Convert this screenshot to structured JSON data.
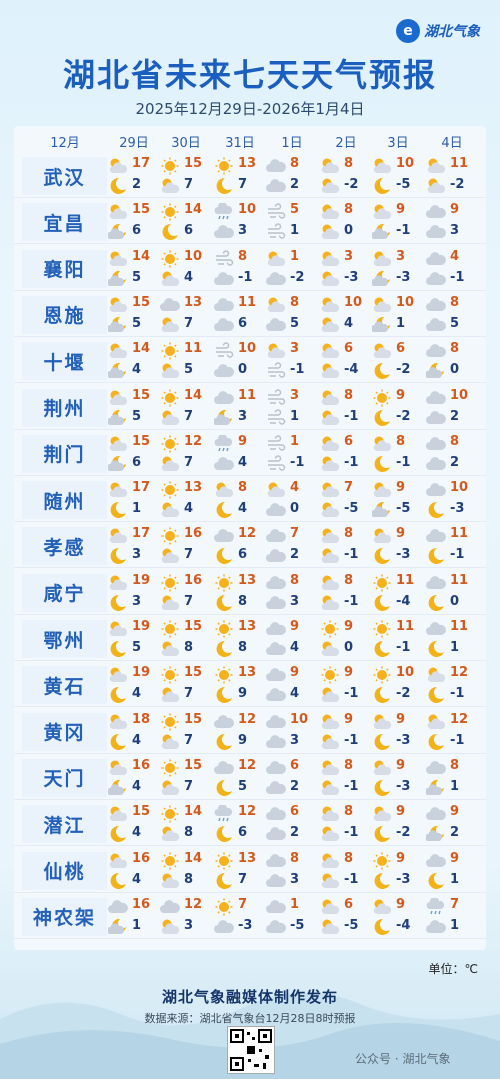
{
  "brand": {
    "logo_text": "湖北气象"
  },
  "title": "湖北省未来七天天气预报",
  "subtitle": "2025年12月29日-2026年1月4日",
  "header": {
    "month": "12月",
    "days": [
      "29日",
      "30日",
      "31日",
      "1日",
      "2日",
      "3日",
      "4日"
    ]
  },
  "rows": [
    {
      "city": "武汉",
      "days": [
        {
          "ti": "pc_day",
          "hi": "17",
          "bi": "moon",
          "lo": "2"
        },
        {
          "ti": "sun",
          "hi": "15",
          "bi": "pc_day",
          "lo": "7"
        },
        {
          "ti": "sun",
          "hi": "13",
          "bi": "moon",
          "lo": "7"
        },
        {
          "ti": "cloud",
          "hi": "8",
          "bi": "cloud",
          "lo": "2"
        },
        {
          "ti": "pc_day",
          "hi": "8",
          "bi": "pc_day",
          "lo": "-2"
        },
        {
          "ti": "pc_day",
          "hi": "10",
          "bi": "moon",
          "lo": "-5"
        },
        {
          "ti": "pc_day",
          "hi": "11",
          "bi": "pc_day",
          "lo": "-2"
        }
      ]
    },
    {
      "city": "宜昌",
      "days": [
        {
          "ti": "pc_day",
          "hi": "15",
          "bi": "pc_night",
          "lo": "6"
        },
        {
          "ti": "sun",
          "hi": "14",
          "bi": "moon",
          "lo": "6"
        },
        {
          "ti": "rain",
          "hi": "10",
          "bi": "cloud",
          "lo": "3"
        },
        {
          "ti": "wind",
          "hi": "5",
          "bi": "wind",
          "lo": "1"
        },
        {
          "ti": "pc_day",
          "hi": "8",
          "bi": "pc_day",
          "lo": "0"
        },
        {
          "ti": "pc_day",
          "hi": "9",
          "bi": "pc_night",
          "lo": "-1"
        },
        {
          "ti": "cloud",
          "hi": "9",
          "bi": "cloud",
          "lo": "3"
        }
      ]
    },
    {
      "city": "襄阳",
      "days": [
        {
          "ti": "pc_day",
          "hi": "14",
          "bi": "pc_night",
          "lo": "5"
        },
        {
          "ti": "sun",
          "hi": "10",
          "bi": "pc_day",
          "lo": "4"
        },
        {
          "ti": "wind",
          "hi": "8",
          "bi": "cloud",
          "lo": "-1"
        },
        {
          "ti": "pc_day",
          "hi": "1",
          "bi": "cloud",
          "lo": "-2"
        },
        {
          "ti": "pc_day",
          "hi": "3",
          "bi": "pc_day",
          "lo": "-3"
        },
        {
          "ti": "pc_day",
          "hi": "3",
          "bi": "pc_night",
          "lo": "-3"
        },
        {
          "ti": "cloud",
          "hi": "4",
          "bi": "cloud",
          "lo": "-1"
        }
      ]
    },
    {
      "city": "恩施",
      "days": [
        {
          "ti": "pc_day",
          "hi": "15",
          "bi": "pc_night",
          "lo": "5"
        },
        {
          "ti": "cloud",
          "hi": "13",
          "bi": "pc_day",
          "lo": "7"
        },
        {
          "ti": "cloud",
          "hi": "11",
          "bi": "cloud",
          "lo": "6"
        },
        {
          "ti": "pc_day",
          "hi": "8",
          "bi": "cloud",
          "lo": "5"
        },
        {
          "ti": "pc_day",
          "hi": "10",
          "bi": "pc_day",
          "lo": "4"
        },
        {
          "ti": "pc_day",
          "hi": "10",
          "bi": "pc_night",
          "lo": "1"
        },
        {
          "ti": "cloud",
          "hi": "8",
          "bi": "cloud",
          "lo": "5"
        }
      ]
    },
    {
      "city": "十堰",
      "days": [
        {
          "ti": "pc_day",
          "hi": "14",
          "bi": "pc_night",
          "lo": "4"
        },
        {
          "ti": "sun",
          "hi": "11",
          "bi": "pc_day",
          "lo": "5"
        },
        {
          "ti": "wind",
          "hi": "10",
          "bi": "cloud",
          "lo": "0"
        },
        {
          "ti": "pc_day",
          "hi": "3",
          "bi": "wind",
          "lo": "-1"
        },
        {
          "ti": "pc_day",
          "hi": "6",
          "bi": "pc_day",
          "lo": "-4"
        },
        {
          "ti": "pc_day",
          "hi": "6",
          "bi": "moon",
          "lo": "-2"
        },
        {
          "ti": "cloud",
          "hi": "8",
          "bi": "pc_night",
          "lo": "0"
        }
      ]
    },
    {
      "city": "荆州",
      "days": [
        {
          "ti": "pc_day",
          "hi": "15",
          "bi": "pc_night",
          "lo": "5"
        },
        {
          "ti": "sun",
          "hi": "14",
          "bi": "pc_day",
          "lo": "7"
        },
        {
          "ti": "cloud",
          "hi": "11",
          "bi": "pc_night",
          "lo": "3"
        },
        {
          "ti": "wind",
          "hi": "3",
          "bi": "wind",
          "lo": "1"
        },
        {
          "ti": "pc_day",
          "hi": "8",
          "bi": "pc_day",
          "lo": "-1"
        },
        {
          "ti": "sun",
          "hi": "9",
          "bi": "moon",
          "lo": "-2"
        },
        {
          "ti": "cloud",
          "hi": "10",
          "bi": "cloud",
          "lo": "2"
        }
      ]
    },
    {
      "city": "荆门",
      "days": [
        {
          "ti": "pc_day",
          "hi": "15",
          "bi": "pc_night",
          "lo": "6"
        },
        {
          "ti": "sun",
          "hi": "12",
          "bi": "pc_day",
          "lo": "7"
        },
        {
          "ti": "rain",
          "hi": "9",
          "bi": "cloud",
          "lo": "4"
        },
        {
          "ti": "wind",
          "hi": "1",
          "bi": "wind",
          "lo": "-1"
        },
        {
          "ti": "pc_day",
          "hi": "6",
          "bi": "pc_day",
          "lo": "-1"
        },
        {
          "ti": "pc_day",
          "hi": "8",
          "bi": "moon",
          "lo": "-1"
        },
        {
          "ti": "cloud",
          "hi": "8",
          "bi": "cloud",
          "lo": "2"
        }
      ]
    },
    {
      "city": "随州",
      "days": [
        {
          "ti": "pc_day",
          "hi": "17",
          "bi": "moon",
          "lo": "1"
        },
        {
          "ti": "sun",
          "hi": "13",
          "bi": "pc_day",
          "lo": "4"
        },
        {
          "ti": "pc_day",
          "hi": "8",
          "bi": "moon",
          "lo": "4"
        },
        {
          "ti": "pc_day",
          "hi": "4",
          "bi": "cloud",
          "lo": "0"
        },
        {
          "ti": "pc_day",
          "hi": "7",
          "bi": "pc_day",
          "lo": "-5"
        },
        {
          "ti": "pc_day",
          "hi": "9",
          "bi": "pc_night",
          "lo": "-5"
        },
        {
          "ti": "cloud",
          "hi": "10",
          "bi": "moon",
          "lo": "-3"
        }
      ]
    },
    {
      "city": "孝感",
      "days": [
        {
          "ti": "pc_day",
          "hi": "17",
          "bi": "moon",
          "lo": "3"
        },
        {
          "ti": "sun",
          "hi": "16",
          "bi": "pc_day",
          "lo": "7"
        },
        {
          "ti": "cloud",
          "hi": "12",
          "bi": "moon",
          "lo": "6"
        },
        {
          "ti": "cloud",
          "hi": "7",
          "bi": "cloud",
          "lo": "2"
        },
        {
          "ti": "pc_day",
          "hi": "8",
          "bi": "pc_day",
          "lo": "-1"
        },
        {
          "ti": "pc_day",
          "hi": "9",
          "bi": "moon",
          "lo": "-3"
        },
        {
          "ti": "cloud",
          "hi": "11",
          "bi": "moon",
          "lo": "-1"
        }
      ]
    },
    {
      "city": "咸宁",
      "days": [
        {
          "ti": "pc_day",
          "hi": "19",
          "bi": "moon",
          "lo": "3"
        },
        {
          "ti": "sun",
          "hi": "16",
          "bi": "pc_day",
          "lo": "7"
        },
        {
          "ti": "sun",
          "hi": "13",
          "bi": "moon",
          "lo": "8"
        },
        {
          "ti": "cloud",
          "hi": "8",
          "bi": "cloud",
          "lo": "3"
        },
        {
          "ti": "pc_day",
          "hi": "8",
          "bi": "pc_day",
          "lo": "-1"
        },
        {
          "ti": "sun",
          "hi": "11",
          "bi": "moon",
          "lo": "-4"
        },
        {
          "ti": "cloud",
          "hi": "11",
          "bi": "moon",
          "lo": "0"
        }
      ]
    },
    {
      "city": "鄂州",
      "days": [
        {
          "ti": "pc_day",
          "hi": "19",
          "bi": "moon",
          "lo": "5"
        },
        {
          "ti": "sun",
          "hi": "15",
          "bi": "pc_day",
          "lo": "8"
        },
        {
          "ti": "sun",
          "hi": "13",
          "bi": "moon",
          "lo": "8"
        },
        {
          "ti": "cloud",
          "hi": "9",
          "bi": "cloud",
          "lo": "4"
        },
        {
          "ti": "sun",
          "hi": "9",
          "bi": "pc_day",
          "lo": "0"
        },
        {
          "ti": "sun",
          "hi": "11",
          "bi": "moon",
          "lo": "-1"
        },
        {
          "ti": "cloud",
          "hi": "11",
          "bi": "moon",
          "lo": "1"
        }
      ]
    },
    {
      "city": "黄石",
      "days": [
        {
          "ti": "pc_day",
          "hi": "19",
          "bi": "moon",
          "lo": "4"
        },
        {
          "ti": "sun",
          "hi": "15",
          "bi": "pc_day",
          "lo": "7"
        },
        {
          "ti": "sun",
          "hi": "13",
          "bi": "moon",
          "lo": "9"
        },
        {
          "ti": "cloud",
          "hi": "9",
          "bi": "cloud",
          "lo": "4"
        },
        {
          "ti": "sun",
          "hi": "9",
          "bi": "pc_day",
          "lo": "-1"
        },
        {
          "ti": "sun",
          "hi": "10",
          "bi": "moon",
          "lo": "-2"
        },
        {
          "ti": "pc_day",
          "hi": "12",
          "bi": "moon",
          "lo": "-1"
        }
      ]
    },
    {
      "city": "黄冈",
      "days": [
        {
          "ti": "pc_day",
          "hi": "18",
          "bi": "moon",
          "lo": "4"
        },
        {
          "ti": "sun",
          "hi": "15",
          "bi": "pc_day",
          "lo": "7"
        },
        {
          "ti": "cloud",
          "hi": "12",
          "bi": "moon",
          "lo": "9"
        },
        {
          "ti": "cloud",
          "hi": "10",
          "bi": "cloud",
          "lo": "3"
        },
        {
          "ti": "pc_day",
          "hi": "9",
          "bi": "pc_day",
          "lo": "-1"
        },
        {
          "ti": "pc_day",
          "hi": "9",
          "bi": "moon",
          "lo": "-3"
        },
        {
          "ti": "pc_day",
          "hi": "12",
          "bi": "moon",
          "lo": "-1"
        }
      ]
    },
    {
      "city": "天门",
      "days": [
        {
          "ti": "pc_day",
          "hi": "16",
          "bi": "pc_night",
          "lo": "4"
        },
        {
          "ti": "sun",
          "hi": "15",
          "bi": "pc_day",
          "lo": "7"
        },
        {
          "ti": "cloud",
          "hi": "12",
          "bi": "moon",
          "lo": "5"
        },
        {
          "ti": "cloud",
          "hi": "6",
          "bi": "cloud",
          "lo": "2"
        },
        {
          "ti": "pc_day",
          "hi": "8",
          "bi": "pc_day",
          "lo": "-1"
        },
        {
          "ti": "pc_day",
          "hi": "9",
          "bi": "moon",
          "lo": "-3"
        },
        {
          "ti": "cloud",
          "hi": "8",
          "bi": "pc_night",
          "lo": "1"
        }
      ]
    },
    {
      "city": "潜江",
      "days": [
        {
          "ti": "pc_day",
          "hi": "15",
          "bi": "moon",
          "lo": "4"
        },
        {
          "ti": "sun",
          "hi": "14",
          "bi": "pc_day",
          "lo": "8"
        },
        {
          "ti": "rain",
          "hi": "12",
          "bi": "moon",
          "lo": "6"
        },
        {
          "ti": "cloud",
          "hi": "6",
          "bi": "cloud",
          "lo": "2"
        },
        {
          "ti": "pc_day",
          "hi": "8",
          "bi": "pc_day",
          "lo": "-1"
        },
        {
          "ti": "pc_day",
          "hi": "9",
          "bi": "moon",
          "lo": "-2"
        },
        {
          "ti": "cloud",
          "hi": "9",
          "bi": "pc_night",
          "lo": "2"
        }
      ]
    },
    {
      "city": "仙桃",
      "days": [
        {
          "ti": "pc_day",
          "hi": "16",
          "bi": "moon",
          "lo": "4"
        },
        {
          "ti": "sun",
          "hi": "14",
          "bi": "pc_day",
          "lo": "8"
        },
        {
          "ti": "sun",
          "hi": "13",
          "bi": "moon",
          "lo": "7"
        },
        {
          "ti": "cloud",
          "hi": "8",
          "bi": "cloud",
          "lo": "3"
        },
        {
          "ti": "pc_day",
          "hi": "8",
          "bi": "pc_day",
          "lo": "-1"
        },
        {
          "ti": "sun",
          "hi": "9",
          "bi": "moon",
          "lo": "-3"
        },
        {
          "ti": "cloud",
          "hi": "9",
          "bi": "moon",
          "lo": "1"
        }
      ]
    },
    {
      "city": "神农架",
      "days": [
        {
          "ti": "cloud",
          "hi": "16",
          "bi": "pc_night",
          "lo": "1"
        },
        {
          "ti": "cloud",
          "hi": "12",
          "bi": "pc_day",
          "lo": "3"
        },
        {
          "ti": "sun",
          "hi": "7",
          "bi": "cloud",
          "lo": "-3"
        },
        {
          "ti": "cloud",
          "hi": "1",
          "bi": "cloud",
          "lo": "-5"
        },
        {
          "ti": "pc_day",
          "hi": "6",
          "bi": "pc_day",
          "lo": "-5"
        },
        {
          "ti": "pc_day",
          "hi": "9",
          "bi": "moon",
          "lo": "-4"
        },
        {
          "ti": "rain",
          "hi": "7",
          "bi": "cloud",
          "lo": "1"
        }
      ]
    }
  ],
  "unit": "单位：℃",
  "footer": {
    "title": "湖北气象融媒体制作发布",
    "source": "数据来源：湖北省气象台12月28日8时预报"
  },
  "watermark": "公众号 · 湖北气象",
  "colors": {
    "title": "#1a5fbf",
    "high_temp": "#d45a1c",
    "low_temp": "#1f3f7a",
    "city": "#2360b8"
  }
}
